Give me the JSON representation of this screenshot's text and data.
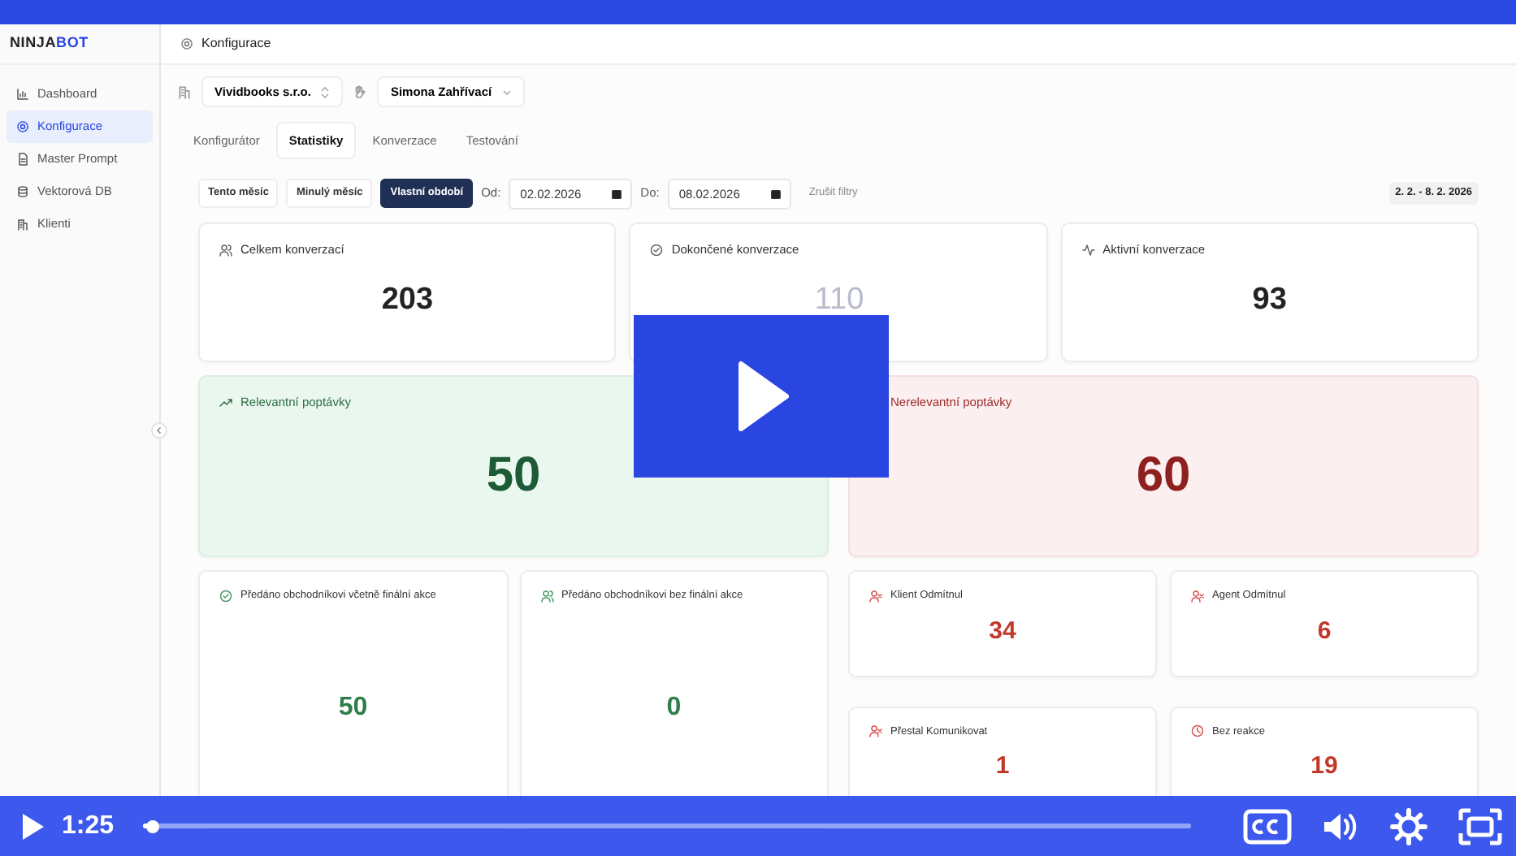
{
  "app": {
    "logo": {
      "part_1": "NINJA",
      "part_2": "BOT"
    },
    "sidebar": {
      "items": [
        {
          "label": "Dashboard",
          "selected": false
        },
        {
          "label": "Konfigurace",
          "selected": true
        },
        {
          "label": "Master Prompt",
          "selected": false
        },
        {
          "label": "Vektorová DB",
          "selected": false
        },
        {
          "label": "Klienti",
          "selected": false
        }
      ]
    },
    "breadcrumb": "Konfigurace",
    "company_select": "Vividbooks s.r.o.",
    "user_select": "Simona Zahřívací",
    "tabs": [
      {
        "label": "Konfigurátor",
        "selected": false
      },
      {
        "label": "Statistiky",
        "selected": true
      },
      {
        "label": "Konverzace",
        "selected": false
      },
      {
        "label": "Testování",
        "selected": false
      }
    ],
    "filters": {
      "presets": [
        {
          "label": "Tento měsíc",
          "selected": false
        },
        {
          "label": "Minulý měsíc",
          "selected": false
        },
        {
          "label": "Vlastní období",
          "selected": true
        }
      ],
      "from_label": "Od:",
      "from_value": "02.02.2026",
      "to_label": "Do:",
      "to_value": "08.02.2026",
      "clear": "Zrušit filtry",
      "range_badge": "2. 2. - 8. 2. 2026"
    },
    "summary_cards": [
      {
        "title": "Celkem konverzací",
        "value": "203"
      },
      {
        "title": "Dokončené konverzace",
        "value": "110"
      },
      {
        "title": "Aktivní konverzace",
        "value": "93"
      }
    ],
    "panels": [
      {
        "kind": "positive",
        "title": "Relevantní poptávky",
        "value": "50"
      },
      {
        "kind": "negative",
        "title": "Nerelevantní poptávky",
        "value": "60"
      }
    ],
    "relevant_breakdown": [
      {
        "title": "Předáno obchodníkovi včetně finální akce",
        "value": "50"
      },
      {
        "title": "Předáno obchodníkovi bez finální akce",
        "value": "0"
      }
    ],
    "irrelevant_breakdown": [
      {
        "title": "Klient Odmítnul",
        "value": "34"
      },
      {
        "title": "Agent Odmítnul",
        "value": "6"
      },
      {
        "title": "Přestal Komunikovat",
        "value": "1"
      },
      {
        "title": "Bez reakce",
        "value": "19"
      }
    ]
  },
  "video": {
    "timestamp": "1:25",
    "progress": {
      "level": 0.01
    }
  }
}
